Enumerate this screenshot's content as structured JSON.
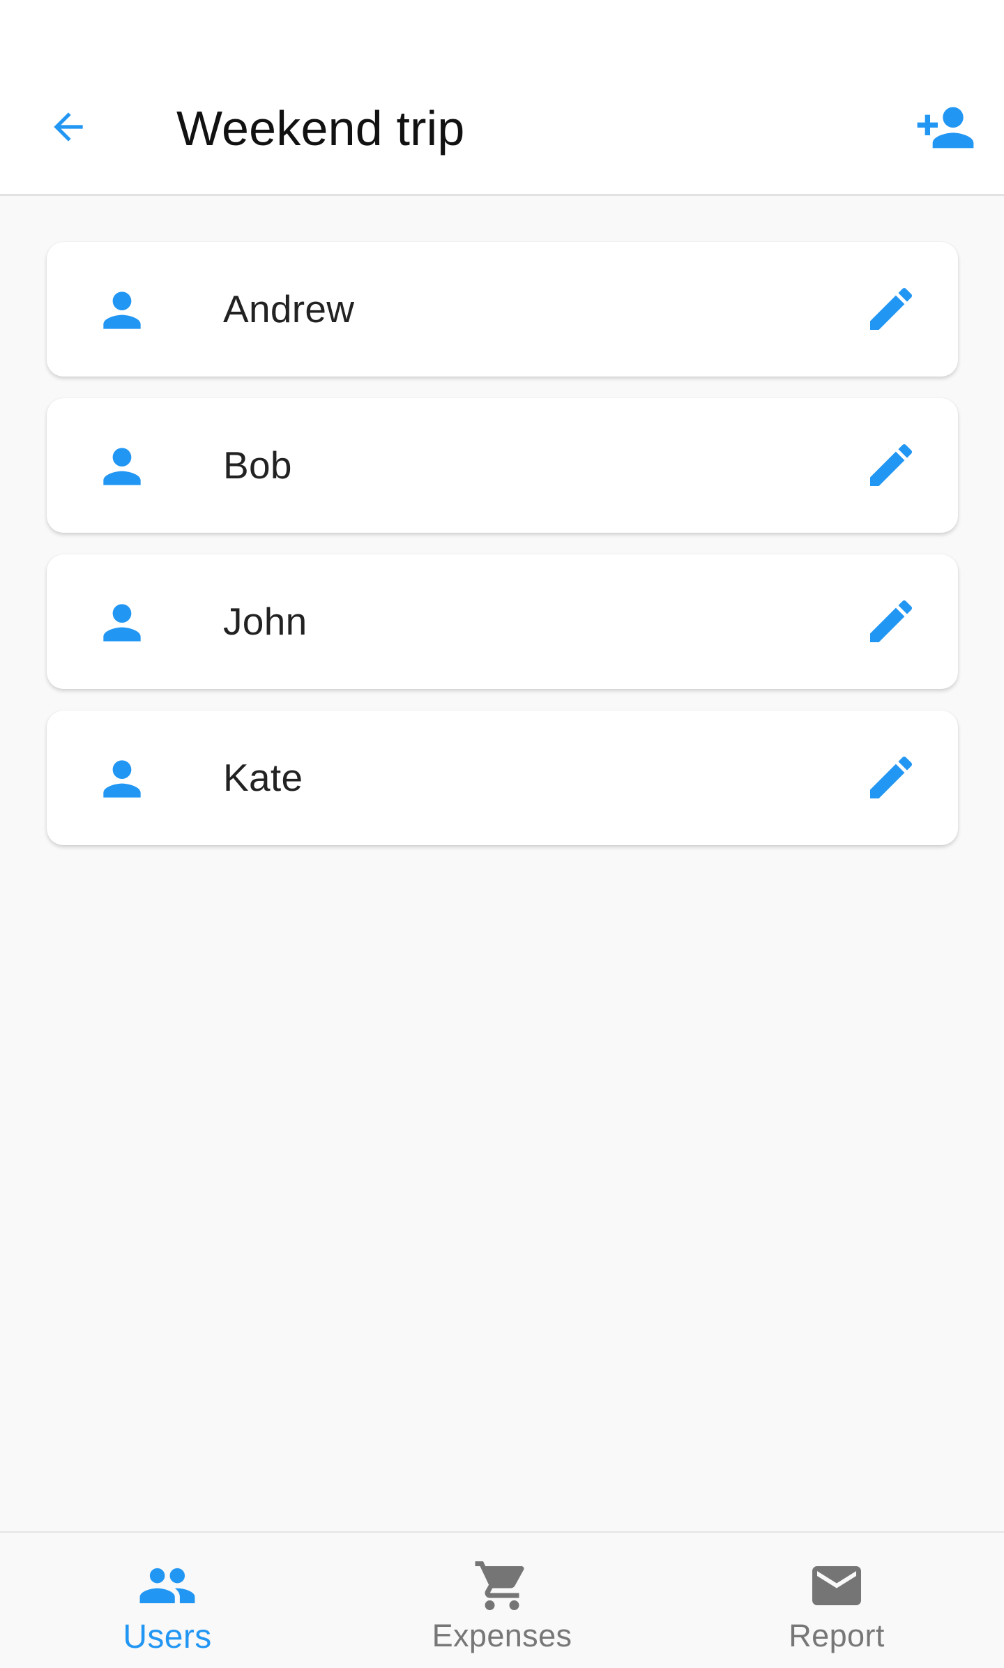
{
  "colors": {
    "accent": "#2196f3",
    "inactive": "#757575"
  },
  "header": {
    "title": "Weekend trip",
    "back_icon": "arrow-back-icon",
    "add_icon": "person-add-icon"
  },
  "users": [
    {
      "name": "Andrew",
      "icon": "person-icon",
      "action_icon": "edit-pencil-icon"
    },
    {
      "name": "Bob",
      "icon": "person-icon",
      "action_icon": "edit-pencil-icon"
    },
    {
      "name": "John",
      "icon": "person-icon",
      "action_icon": "edit-pencil-icon"
    },
    {
      "name": "Kate",
      "icon": "person-icon",
      "action_icon": "edit-pencil-icon"
    }
  ],
  "nav": {
    "items": [
      {
        "label": "Users",
        "icon": "people-icon",
        "active": true
      },
      {
        "label": "Expenses",
        "icon": "shopping-cart-icon",
        "active": false
      },
      {
        "label": "Report",
        "icon": "mail-icon",
        "active": false
      }
    ]
  }
}
